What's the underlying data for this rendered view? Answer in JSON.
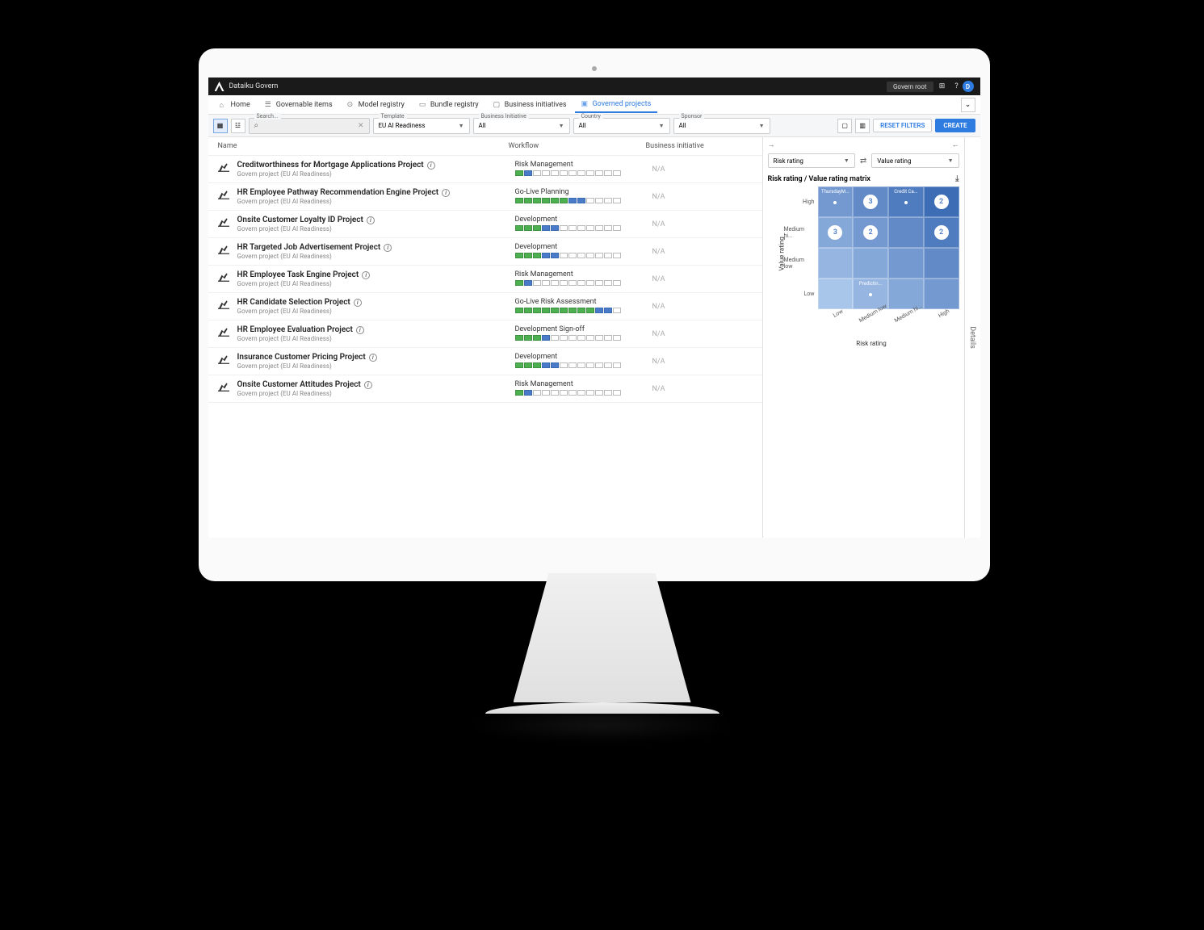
{
  "app": {
    "name": "Dataiku Govern",
    "user_chip": "Govern root",
    "avatar": "D"
  },
  "nav": [
    {
      "label": "Home",
      "icon": "home"
    },
    {
      "label": "Governable items",
      "icon": "list"
    },
    {
      "label": "Model registry",
      "icon": "model"
    },
    {
      "label": "Bundle registry",
      "icon": "bundle"
    },
    {
      "label": "Business initiatives",
      "icon": "biz"
    },
    {
      "label": "Governed projects",
      "icon": "proj",
      "active": true
    }
  ],
  "filters": {
    "search": {
      "label": "Search...",
      "value": ""
    },
    "template": {
      "label": "Template",
      "value": "EU AI Readiness"
    },
    "business_initiative": {
      "label": "Business Initiative",
      "value": "All"
    },
    "country": {
      "label": "Country",
      "value": "All"
    },
    "sponsor": {
      "label": "Sponsor",
      "value": "All"
    },
    "reset": "RESET FILTERS",
    "create": "CREATE"
  },
  "table": {
    "headers": {
      "name": "Name",
      "workflow": "Workflow",
      "bi": "Business initiative"
    },
    "rows": [
      {
        "title": "Creditworthiness for Mortgage Applications Project",
        "sub": "Govern project (EU AI Readiness)",
        "wf": "Risk Management",
        "seg": "gb----------",
        "bi": "N/A"
      },
      {
        "title": "HR Employee Pathway Recommendation Engine Project",
        "sub": "Govern project (EU AI Readiness)",
        "wf": "Go-Live Planning",
        "seg": "ggggggbb----",
        "bi": "N/A"
      },
      {
        "title": "Onsite Customer Loyalty ID Project",
        "sub": "Govern project (EU AI Readiness)",
        "wf": "Development",
        "seg": "gggbb-------",
        "bi": "N/A"
      },
      {
        "title": "HR Targeted Job Advertisement Project",
        "sub": "Govern project (EU AI Readiness)",
        "wf": "Development",
        "seg": "gggbb-------",
        "bi": "N/A"
      },
      {
        "title": "HR Employee Task Engine Project",
        "sub": "Govern project (EU AI Readiness)",
        "wf": "Risk Management",
        "seg": "gb----------",
        "bi": "N/A"
      },
      {
        "title": "HR Candidate Selection Project",
        "sub": "Govern project (EU AI Readiness)",
        "wf": "Go-Live Risk Assessment",
        "seg": "gggggggggbb-",
        "bi": "N/A"
      },
      {
        "title": "HR Employee Evaluation Project",
        "sub": "Govern project (EU AI Readiness)",
        "wf": "Development Sign-off",
        "seg": "gggb--------",
        "bi": "N/A"
      },
      {
        "title": "Insurance Customer Pricing Project",
        "sub": "Govern project (EU AI Readiness)",
        "wf": "Development",
        "seg": "gggbb-------",
        "bi": "N/A"
      },
      {
        "title": "Onsite Customer Attitudes Project",
        "sub": "Govern project (EU AI Readiness)",
        "wf": "Risk Management",
        "seg": "gb----------",
        "bi": "N/A"
      }
    ]
  },
  "matrix": {
    "x_axis_select": "Risk rating",
    "y_axis_select": "Value rating",
    "title": "Risk rating / Value rating matrix",
    "x_label": "Risk rating",
    "y_label": "Value rating",
    "y_ticks": [
      "High",
      "Medium hi...",
      "Medium low",
      "Low"
    ],
    "x_ticks": [
      "Low",
      "Medium low",
      "Medium hi...",
      "High"
    ],
    "details": "Details"
  },
  "chart_data": {
    "type": "heatmap",
    "title": "Risk rating / Value rating matrix",
    "xlabel": "Risk rating",
    "ylabel": "Value rating",
    "x_categories": [
      "Low",
      "Medium low",
      "Medium high",
      "High"
    ],
    "y_categories": [
      "High",
      "Medium high",
      "Medium low",
      "Low"
    ],
    "cells": [
      {
        "x": "Low",
        "y": "High",
        "label": "ThursdayM...",
        "count": 1
      },
      {
        "x": "Medium low",
        "y": "High",
        "count": 3
      },
      {
        "x": "Medium high",
        "y": "High",
        "label": "Credit Ca...",
        "count": 1
      },
      {
        "x": "High",
        "y": "High",
        "count": 2
      },
      {
        "x": "Low",
        "y": "Medium high",
        "count": 3
      },
      {
        "x": "Medium low",
        "y": "Medium high",
        "count": 2
      },
      {
        "x": "High",
        "y": "Medium high",
        "count": 2
      },
      {
        "x": "Medium low",
        "y": "Low",
        "label": "Predictin...",
        "count": 1
      }
    ],
    "gradient": {
      "low": "#a8c5ea",
      "high": "#3d6db5"
    }
  }
}
